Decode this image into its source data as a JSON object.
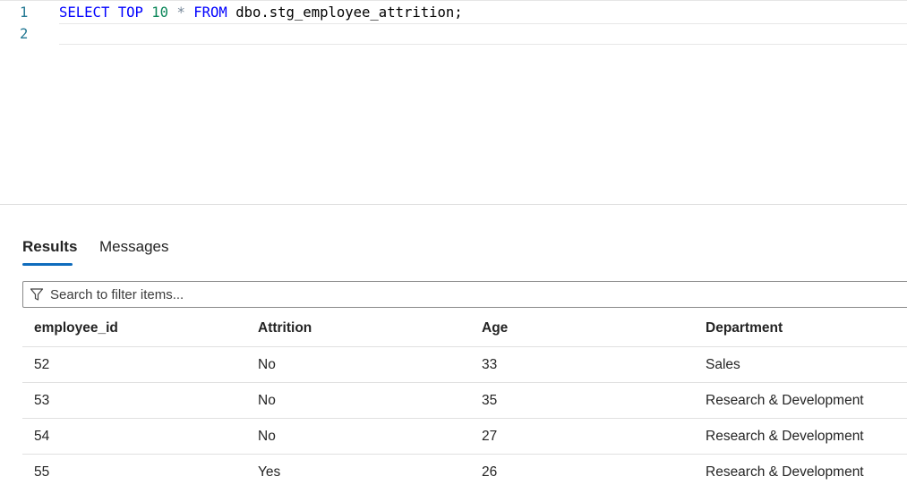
{
  "editor": {
    "lines": [
      {
        "number": "1",
        "tokens": {
          "select": "SELECT",
          "top": "TOP",
          "limit": "10",
          "star": "*",
          "from": "FROM",
          "table": "dbo.stg_employee_attrition;"
        }
      },
      {
        "number": "2"
      }
    ]
  },
  "results": {
    "tabs": [
      {
        "label": "Results",
        "active": true
      },
      {
        "label": "Messages",
        "active": false
      }
    ],
    "filter": {
      "placeholder": "Search to filter items...",
      "value": ""
    },
    "columns": [
      "employee_id",
      "Attrition",
      "Age",
      "Department"
    ],
    "rows": [
      [
        "52",
        "No",
        "33",
        "Sales"
      ],
      [
        "53",
        "No",
        "35",
        "Research & Development"
      ],
      [
        "54",
        "No",
        "27",
        "Research & Development"
      ],
      [
        "55",
        "Yes",
        "26",
        "Research & Development"
      ]
    ]
  },
  "colors": {
    "keyword": "#0000ff",
    "number": "#098658",
    "line_number": "#237893",
    "accent": "#0f6cbd"
  },
  "icons": {
    "filter": "filter-funnel-icon"
  }
}
